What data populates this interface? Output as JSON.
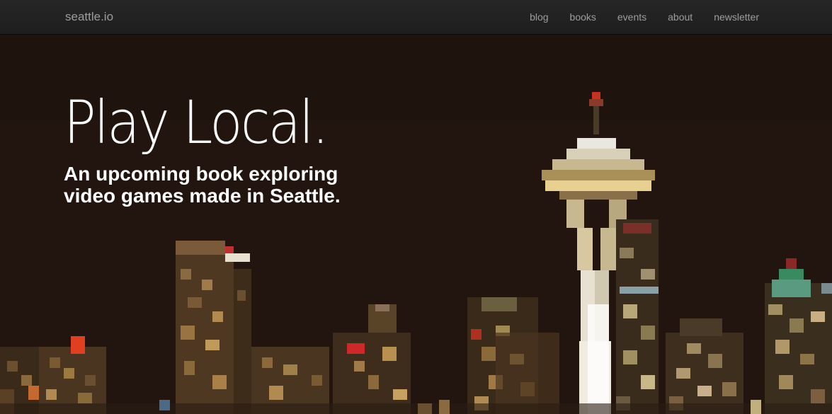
{
  "nav": {
    "brand": "seattle.io",
    "links": [
      {
        "label": "blog"
      },
      {
        "label": "books"
      },
      {
        "label": "events"
      },
      {
        "label": "about"
      },
      {
        "label": "newsletter"
      }
    ]
  },
  "hero": {
    "title": "Play Local.",
    "subtitle": "An upcoming book exploring video games made in Seattle.",
    "background_image": "pixelated-seattle-skyline-at-night"
  },
  "colors": {
    "navbar_bg": "#222222",
    "nav_text": "#9d9d9d",
    "hero_bg": "#21140f",
    "hero_text": "#ffffff"
  }
}
